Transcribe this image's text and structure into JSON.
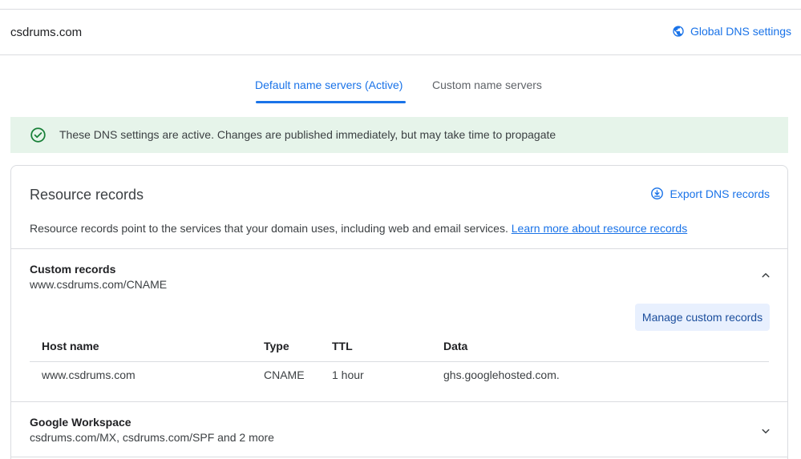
{
  "header": {
    "domain": "csdrums.com",
    "global_dns_label": "Global DNS settings",
    "global_icon": "globe-icon"
  },
  "tabs": [
    {
      "label": "Default name servers (Active)",
      "active": true
    },
    {
      "label": "Custom name servers",
      "active": false
    }
  ],
  "banner": {
    "icon": "check-circle-icon",
    "text": "These DNS settings are active. Changes are published immediately, but may take time to propagate"
  },
  "resource_records": {
    "title": "Resource records",
    "export_label": "Export DNS records",
    "export_icon": "download-icon",
    "description": "Resource records point to the services that your domain uses, including web and email services.",
    "learn_more": "Learn more about resource records"
  },
  "custom_records": {
    "title": "Custom records",
    "subtitle": "www.csdrums.com/CNAME",
    "expanded": true,
    "manage_label": "Manage custom records",
    "columns": [
      "Host name",
      "Type",
      "TTL",
      "Data"
    ],
    "rows": [
      [
        "www.csdrums.com",
        "CNAME",
        "1 hour",
        "ghs.googlehosted.com."
      ]
    ]
  },
  "google_workspace": {
    "title": "Google Workspace",
    "subtitle": "csdrums.com/MX, csdrums.com/SPF and 2 more",
    "expanded": false
  },
  "colors": {
    "accent": "#1a73e8",
    "success_bg": "#e6f4ea",
    "success": "#188038",
    "button_bg": "#e8f0fe"
  }
}
